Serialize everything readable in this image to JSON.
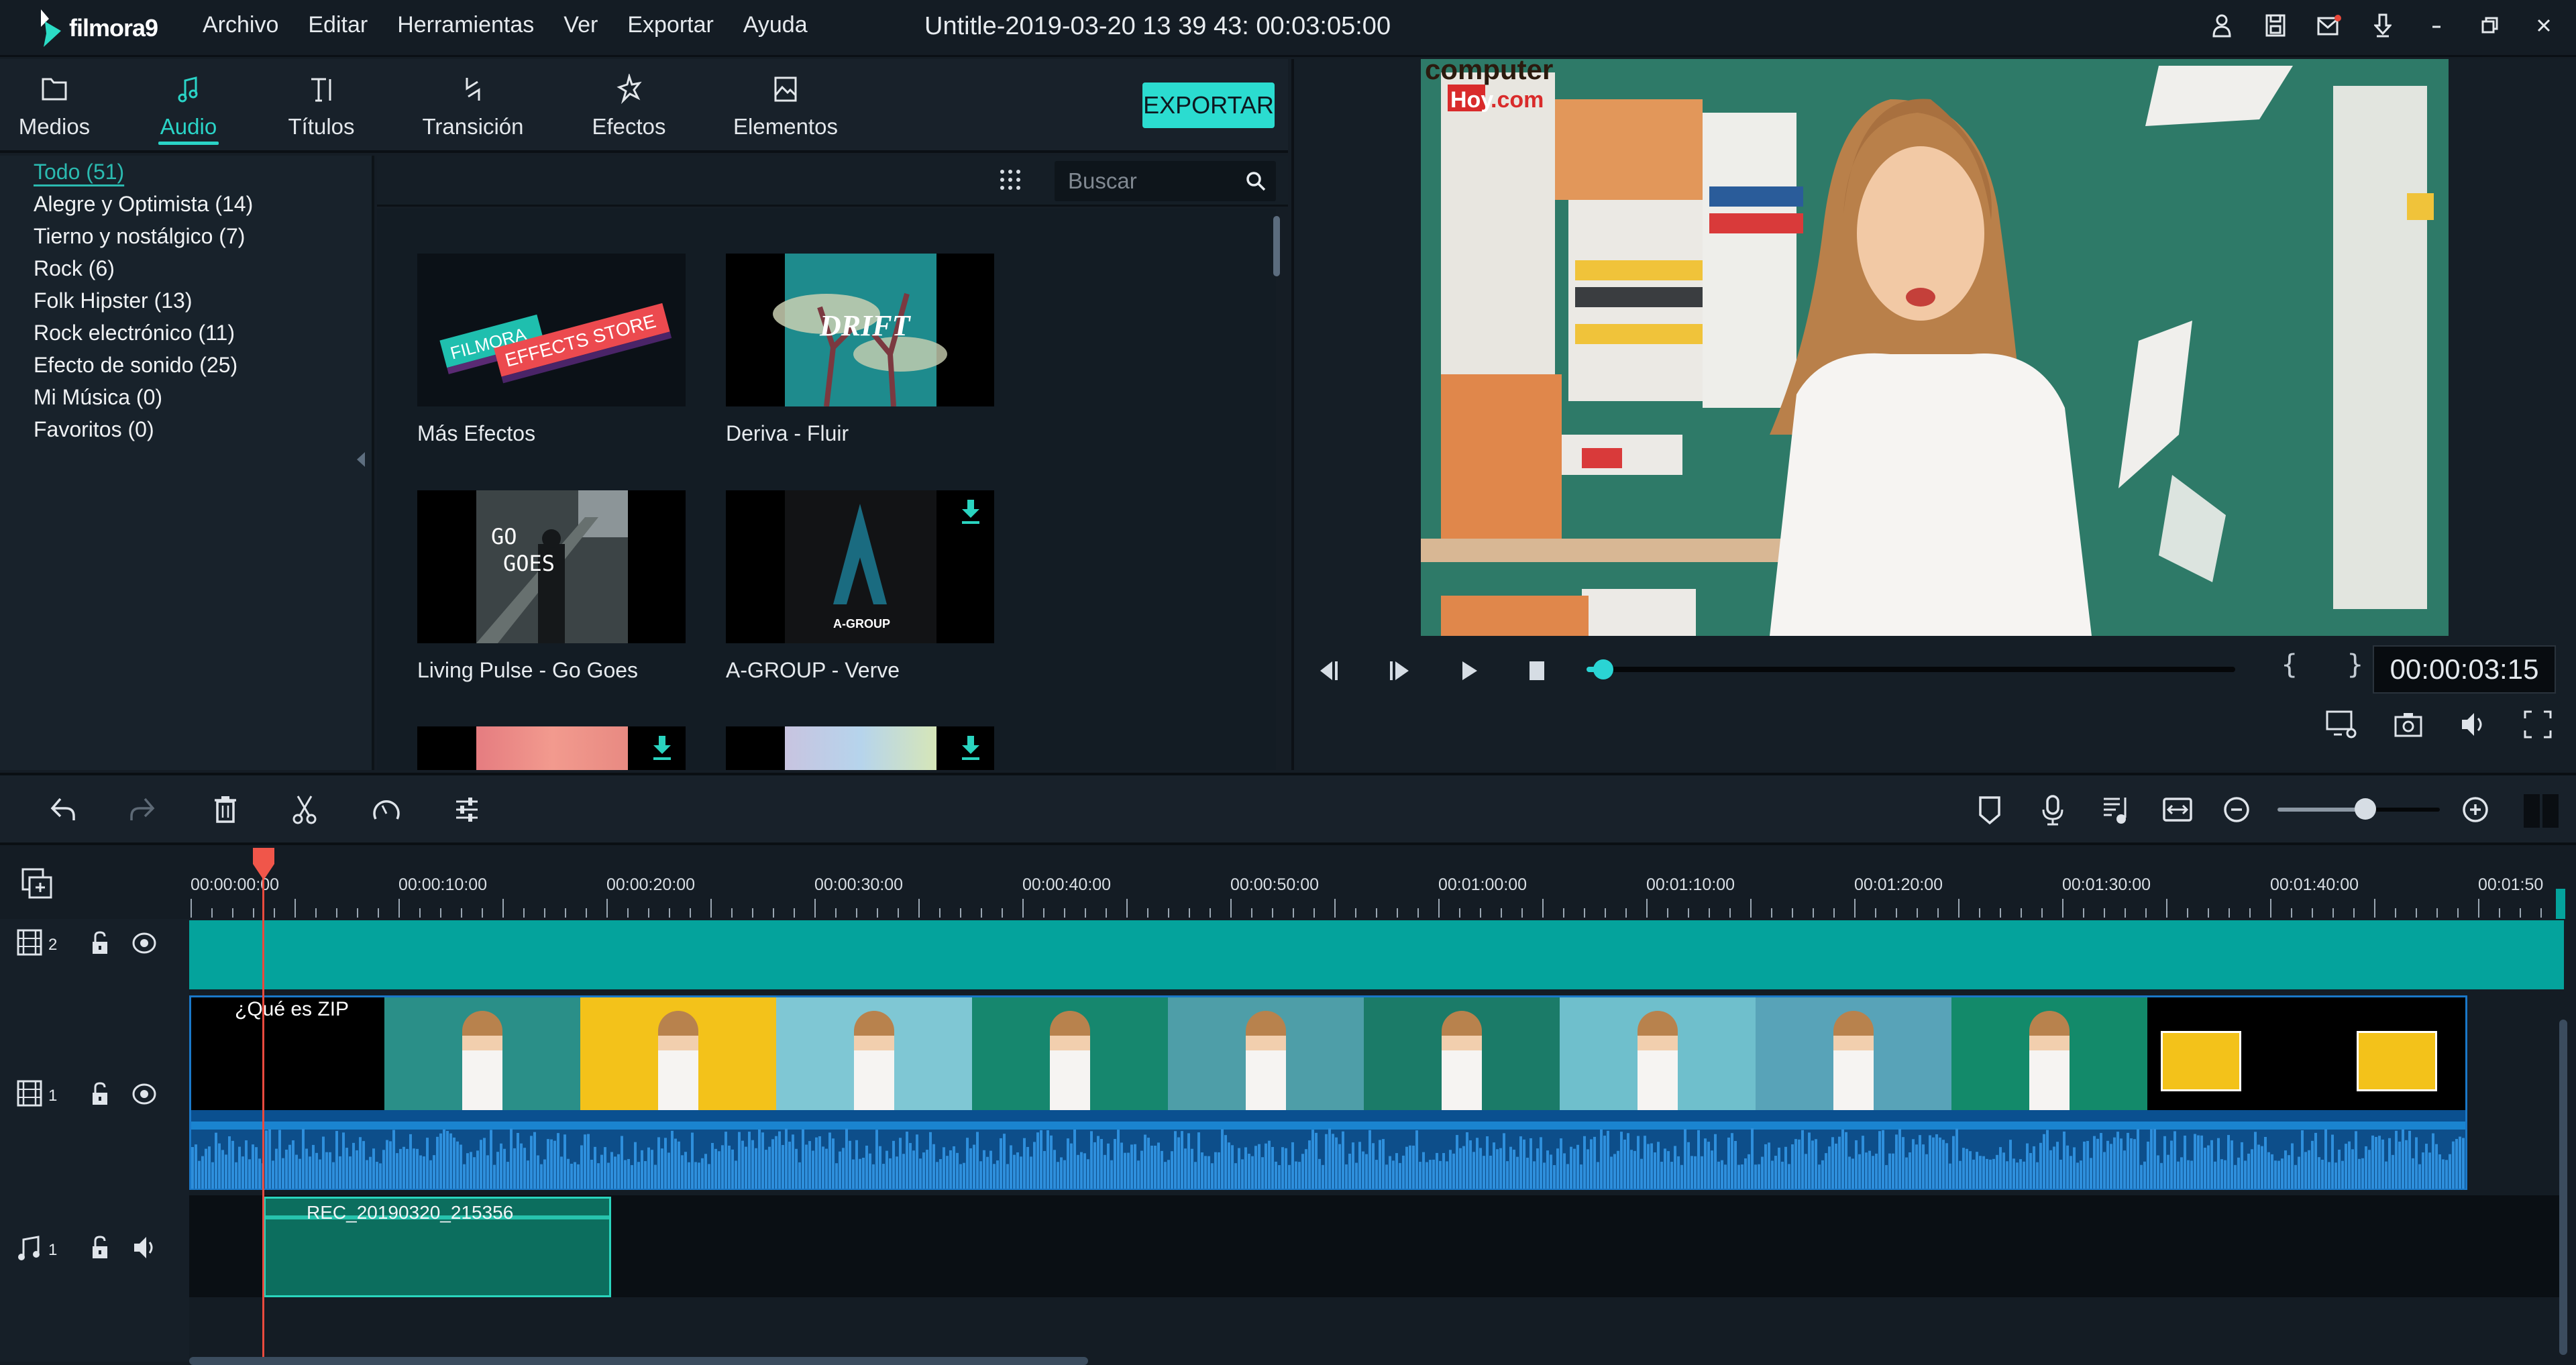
{
  "app": {
    "name": "filmora9",
    "title": "Untitle-2019-03-20 13 39 43:  00:03:05:00",
    "accent_color": "#2ad4c7"
  },
  "menu": [
    "Archivo",
    "Editar",
    "Herramientas",
    "Ver",
    "Exportar",
    "Ayuda"
  ],
  "window_icons": [
    "user-icon",
    "save-icon",
    "mail-icon",
    "download-icon",
    "minimize-icon",
    "restore-icon",
    "close-icon"
  ],
  "tabs": [
    {
      "label": "Medios",
      "icon": "folder-icon",
      "active": false
    },
    {
      "label": "Audio",
      "icon": "music-note-icon",
      "active": true
    },
    {
      "label": "Títulos",
      "icon": "text-icon",
      "active": false
    },
    {
      "label": "Transición",
      "icon": "transition-icon",
      "active": false
    },
    {
      "label": "Efectos",
      "icon": "effects-icon",
      "active": false
    },
    {
      "label": "Elementos",
      "icon": "image-icon",
      "active": false
    }
  ],
  "export_label": "EXPORTAR",
  "categories": [
    {
      "label": "Todo (51)",
      "active": true
    },
    {
      "label": "Alegre y Optimista (14)",
      "active": false
    },
    {
      "label": "Tierno y nostálgico (7)",
      "active": false
    },
    {
      "label": "Rock (6)",
      "active": false
    },
    {
      "label": "Folk Hipster (13)",
      "active": false
    },
    {
      "label": "Rock electrónico (11)",
      "active": false
    },
    {
      "label": "Efecto de sonido (25)",
      "active": false
    },
    {
      "label": "Mi Música (0)",
      "active": false
    },
    {
      "label": "Favoritos (0)",
      "active": false
    }
  ],
  "search": {
    "placeholder": "Buscar",
    "value": ""
  },
  "library_items": [
    {
      "label": "Más Efectos",
      "thumb_text": [
        "FILMORA",
        "EFFECTS STORE"
      ],
      "download": false
    },
    {
      "label": "Deriva - Fluir",
      "thumb_text": [
        "DRIFT"
      ],
      "download": false
    },
    {
      "label": "Living Pulse - Go Goes",
      "thumb_text": [
        "GO",
        "GOES"
      ],
      "download": false
    },
    {
      "label": "A-GROUP - Verve",
      "thumb_text": [
        "A-GROUP"
      ],
      "download": true
    },
    {
      "label": "",
      "thumb_text": [],
      "download": true
    },
    {
      "label": "",
      "thumb_text": [],
      "download": true
    }
  ],
  "preview": {
    "watermark": [
      "computer",
      "Hoy",
      ".com"
    ],
    "timecode": "00:00:03:15",
    "progress_fraction": 0.003,
    "in_out_marks": "{ }"
  },
  "player_buttons": [
    "previous-frame",
    "play-pause-step",
    "play",
    "stop"
  ],
  "preview_tools": [
    "display-settings-icon",
    "snapshot-icon",
    "volume-icon",
    "fullscreen-icon"
  ],
  "timeline_toolbar": {
    "left": [
      "undo-icon",
      "redo-icon",
      "delete-icon",
      "cut-icon",
      "speed-icon",
      "adjust-icon"
    ],
    "right": [
      "marker-icon",
      "microphone-icon",
      "audio-mixer-icon",
      "fit-icon",
      "zoom-out-icon",
      "zoom-in-icon"
    ],
    "zoom_fraction": 0.54
  },
  "ruler": {
    "labels": [
      "00:00:00:00",
      "00:00:10:00",
      "00:00:20:00",
      "00:00:30:00",
      "00:00:40:00",
      "00:00:50:00",
      "00:01:00:00",
      "00:01:10:00",
      "00:01:20:00",
      "00:01:30:00",
      "00:01:40:00",
      "00:01:50"
    ]
  },
  "tracks": [
    {
      "type": "video",
      "number": "2"
    },
    {
      "type": "video",
      "number": "1"
    },
    {
      "type": "audio",
      "number": "1"
    }
  ],
  "clips": {
    "v1_title": "¿Qué es ZIP",
    "audio_clip": "REC_20190320_215356"
  }
}
